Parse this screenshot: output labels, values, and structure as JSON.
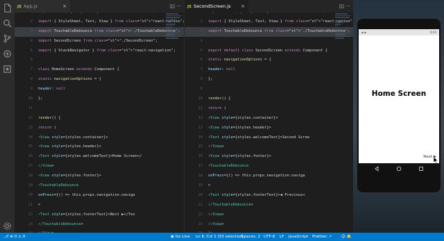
{
  "activity": {
    "icons": [
      "files-icon",
      "search-icon",
      "source-control-icon",
      "debug-icon",
      "extensions-icon",
      "settings-gear-icon"
    ]
  },
  "left_editor": {
    "tab_label": "App.js",
    "tab_icon": "JS",
    "lines": [
      {
        "n": "1",
        "hl": false,
        "t": "import React, { Component } from \"react\";"
      },
      {
        "n": "2",
        "hl": false,
        "t": "import { StyleSheet, Text, View } from \"react-native\";"
      },
      {
        "n": "3",
        "hl": true,
        "t": "import TouchableDebounce from './TouchableDebounce';"
      },
      {
        "n": "4",
        "hl": false,
        "t": "import SecondScreen from \"./SecondScreen\";"
      },
      {
        "n": "5",
        "hl": false,
        "t": "import { StackNavigator } from \"react-navigation\";"
      },
      {
        "n": "6",
        "hl": false,
        "t": ""
      },
      {
        "n": "7",
        "hl": false,
        "t": "class HomeScreen extends Component {"
      },
      {
        "n": "8",
        "hl": false,
        "t": "  static navigationOptions = {"
      },
      {
        "n": "9",
        "hl": false,
        "t": "    header: null"
      },
      {
        "n": "10",
        "hl": false,
        "t": "  };"
      },
      {
        "n": "11",
        "hl": false,
        "t": ""
      },
      {
        "n": "12",
        "hl": false,
        "t": "  render() {"
      },
      {
        "n": "13",
        "hl": false,
        "t": "    return ("
      },
      {
        "n": "14",
        "hl": false,
        "t": "      <View style={styles.container}>"
      },
      {
        "n": "15",
        "hl": false,
        "t": "        <View style={styles.header}>"
      },
      {
        "n": "16",
        "hl": false,
        "t": "          <Text style={styles.welcomeText}>Home Screen</"
      },
      {
        "n": "17",
        "hl": false,
        "t": "        </View>"
      },
      {
        "n": "18",
        "hl": false,
        "t": "        <View style={styles.footer}>"
      },
      {
        "n": "19",
        "hl": false,
        "t": "          <TouchableDebounce"
      },
      {
        "n": "20",
        "hl": false,
        "t": "            onPress={() => this.props.navigation.naviga"
      },
      {
        "n": "21",
        "hl": false,
        "t": "          >"
      },
      {
        "n": "22",
        "hl": false,
        "t": "            <Text style={styles.footerText}>Next ▶</Tex"
      },
      {
        "n": "23",
        "hl": false,
        "t": "          </TouchableDebounce>"
      },
      {
        "n": "24",
        "hl": false,
        "t": "        </View>"
      }
    ]
  },
  "right_editor": {
    "tab_label": "SecondScreen.js",
    "tab_icon": "JS",
    "lines": [
      {
        "n": "1",
        "hl": false,
        "t": "import React, { Component } from \"react\";"
      },
      {
        "n": "2",
        "hl": false,
        "t": "import { StyleSheet, Text, View } from \"react-native\";"
      },
      {
        "n": "3",
        "hl": true,
        "t": "import TouchableDebounce from './TouchableDebounce';"
      },
      {
        "n": "4",
        "hl": false,
        "t": ""
      },
      {
        "n": "5",
        "hl": false,
        "t": "export default class SecondScreen extends Component {"
      },
      {
        "n": "6",
        "hl": false,
        "t": "  static navigationOptions = {"
      },
      {
        "n": "7",
        "hl": false,
        "t": "    header: null"
      },
      {
        "n": "8",
        "hl": false,
        "t": "  };"
      },
      {
        "n": "9",
        "hl": false,
        "t": ""
      },
      {
        "n": "10",
        "hl": false,
        "t": "  render() {"
      },
      {
        "n": "11",
        "hl": false,
        "t": "    return ("
      },
      {
        "n": "12",
        "hl": false,
        "t": "      <View style={styles.container}>"
      },
      {
        "n": "13",
        "hl": false,
        "t": "        <View style={styles.header}>"
      },
      {
        "n": "14",
        "hl": false,
        "t": "          <Text style={styles.welcomeText}>Second Scree"
      },
      {
        "n": "15",
        "hl": false,
        "t": "        </View>"
      },
      {
        "n": "16",
        "hl": false,
        "t": "        <View style={styles.footer}>"
      },
      {
        "n": "17",
        "hl": false,
        "t": "          <TouchableDebounce"
      },
      {
        "n": "18",
        "hl": false,
        "t": "            onPress={() => this.props.navigation.naviga"
      },
      {
        "n": "19",
        "hl": false,
        "t": "          >"
      },
      {
        "n": "20",
        "hl": false,
        "t": "            <Text style={styles.footerText}>◀ Previous<"
      },
      {
        "n": "21",
        "hl": false,
        "t": "          </TouchableDebounce>"
      },
      {
        "n": "22",
        "hl": false,
        "t": "        </View>"
      },
      {
        "n": "23",
        "hl": false,
        "t": "      </View>"
      },
      {
        "n": "24",
        "hl": false,
        "t": "    );"
      }
    ]
  },
  "simulator": {
    "home_title": "Home Screen",
    "next_button": "Next ▶",
    "clock": "8:26"
  },
  "statusbar": {
    "branch_icon": "git-branch-icon",
    "go_live": "Go Live",
    "cursor_pos": "Ln 6, Col 1 (53 selected)",
    "spaces": "Spaces: 2",
    "encoding": "UTF-8",
    "eol": "LF",
    "language": "JavaScript",
    "prettier": "Prettier: ✓"
  },
  "colors": {
    "editor_bg": "#1e1e1e",
    "activity_bg": "#2c2c2c",
    "statusbar_bg": "#007acc",
    "keyword": "#569cd6",
    "string": "#ce9178",
    "highlight": "#3a3d41"
  }
}
